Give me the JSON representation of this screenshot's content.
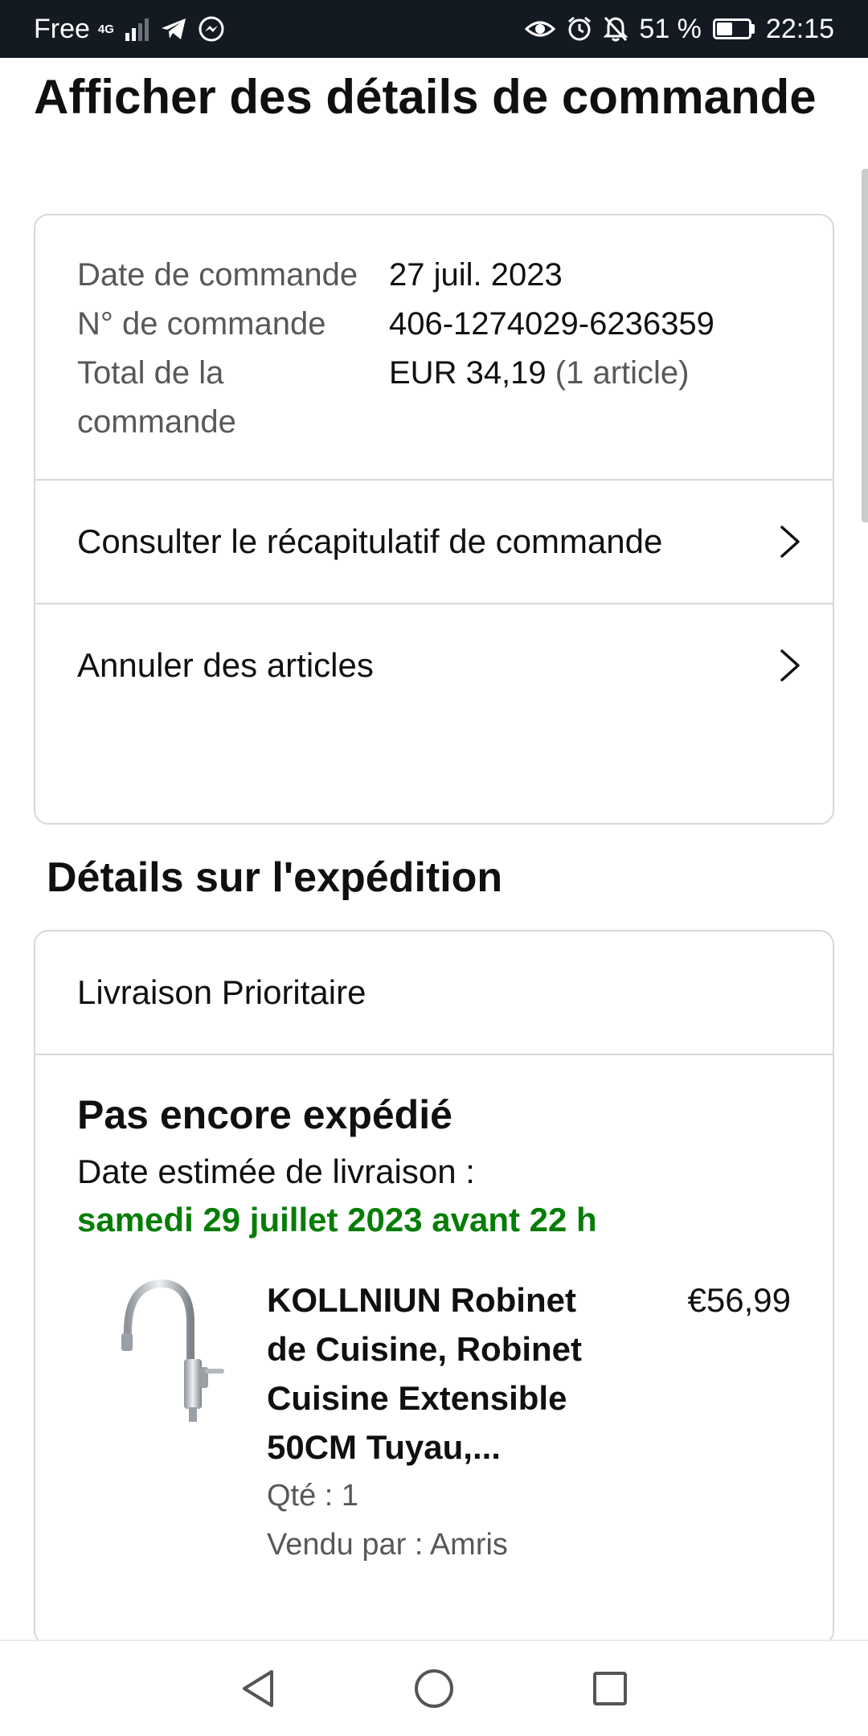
{
  "status_bar": {
    "carrier": "Free",
    "network": "4G",
    "battery_percent": "51 %",
    "battery_level": 0.51,
    "time": "22:15"
  },
  "page": {
    "title": "Afficher des détails de commande"
  },
  "order": {
    "rows": [
      {
        "label": "Date de commande",
        "value": "27 juil. 2023",
        "extra": ""
      },
      {
        "label": "N° de commande",
        "value": "406-1274029-6236359",
        "extra": ""
      },
      {
        "label": "Total de la commande",
        "value": "EUR 34,19",
        "extra": "(1 article)"
      }
    ],
    "links": [
      {
        "label": "Consulter le récapitulatif de commande"
      },
      {
        "label": "Annuler des articles"
      }
    ]
  },
  "shipping": {
    "section_title": "Détails sur l'expédition",
    "method": "Livraison Prioritaire",
    "status": "Pas encore expédié",
    "eta_label": "Date estimée de livraison :",
    "eta_date": "samedi 29 juillet 2023 avant 22 h",
    "eta_color": "#067d06",
    "product": {
      "title": "KOLLNIUN Robinet de Cuisine, Robinet Cuisine Extensible 50CM Tuyau,...",
      "price": "€56,99",
      "quantity": "Qté : 1",
      "seller": "Vendu par : Amris",
      "image_icon": "kitchen-faucet-image"
    }
  },
  "nav_bar": {
    "icons": [
      "back-icon",
      "home-icon",
      "recents-icon"
    ]
  }
}
